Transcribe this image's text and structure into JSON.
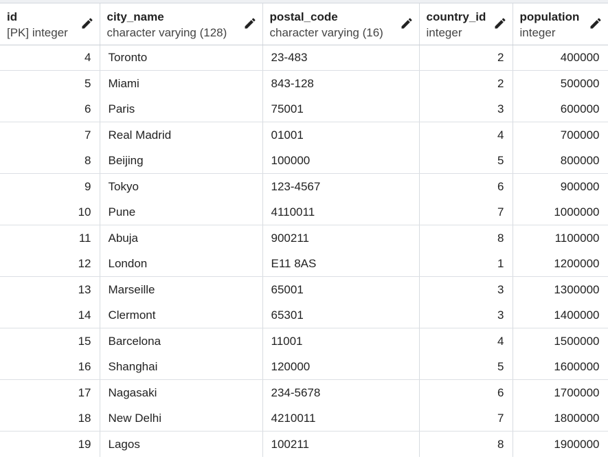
{
  "columns": [
    {
      "key": "id",
      "name": "id",
      "type": "[PK] integer",
      "align": "right"
    },
    {
      "key": "city_name",
      "name": "city_name",
      "type": "character varying (128)",
      "align": "left"
    },
    {
      "key": "postal_code",
      "name": "postal_code",
      "type": "character varying (16)",
      "align": "left"
    },
    {
      "key": "country_id",
      "name": "country_id",
      "type": "integer",
      "align": "right"
    },
    {
      "key": "population",
      "name": "population",
      "type": "integer",
      "align": "right"
    }
  ],
  "icons": {
    "edit": "pencil-icon"
  },
  "rows": [
    {
      "id": "4",
      "city_name": "Toronto",
      "postal_code": "23-483",
      "country_id": "2",
      "population": "400000"
    },
    {
      "id": "5",
      "city_name": "Miami",
      "postal_code": "843-128",
      "country_id": "2",
      "population": "500000"
    },
    {
      "id": "6",
      "city_name": "Paris",
      "postal_code": "75001",
      "country_id": "3",
      "population": "600000"
    },
    {
      "id": "7",
      "city_name": "Real Madrid",
      "postal_code": "01001",
      "country_id": "4",
      "population": "700000"
    },
    {
      "id": "8",
      "city_name": "Beijing",
      "postal_code": "100000",
      "country_id": "5",
      "population": "800000"
    },
    {
      "id": "9",
      "city_name": "Tokyo",
      "postal_code": "123-4567",
      "country_id": "6",
      "population": "900000"
    },
    {
      "id": "10",
      "city_name": "Pune",
      "postal_code": "4110011",
      "country_id": "7",
      "population": "1000000"
    },
    {
      "id": "11",
      "city_name": "Abuja",
      "postal_code": "900211",
      "country_id": "8",
      "population": "1100000"
    },
    {
      "id": "12",
      "city_name": "London",
      "postal_code": "E11 8AS",
      "country_id": "1",
      "population": "1200000"
    },
    {
      "id": "13",
      "city_name": "Marseille",
      "postal_code": "65001",
      "country_id": "3",
      "population": "1300000"
    },
    {
      "id": "14",
      "city_name": "Clermont",
      "postal_code": "65301",
      "country_id": "3",
      "population": "1400000"
    },
    {
      "id": "15",
      "city_name": "Barcelona",
      "postal_code": "11001",
      "country_id": "4",
      "population": "1500000"
    },
    {
      "id": "16",
      "city_name": "Shanghai",
      "postal_code": "120000",
      "country_id": "5",
      "population": "1600000"
    },
    {
      "id": "17",
      "city_name": "Nagasaki",
      "postal_code": "234-5678",
      "country_id": "6",
      "population": "1700000"
    },
    {
      "id": "18",
      "city_name": "New Delhi",
      "postal_code": "4210011",
      "country_id": "7",
      "population": "1800000"
    },
    {
      "id": "19",
      "city_name": "Lagos",
      "postal_code": "100211",
      "country_id": "8",
      "population": "1900000"
    }
  ]
}
